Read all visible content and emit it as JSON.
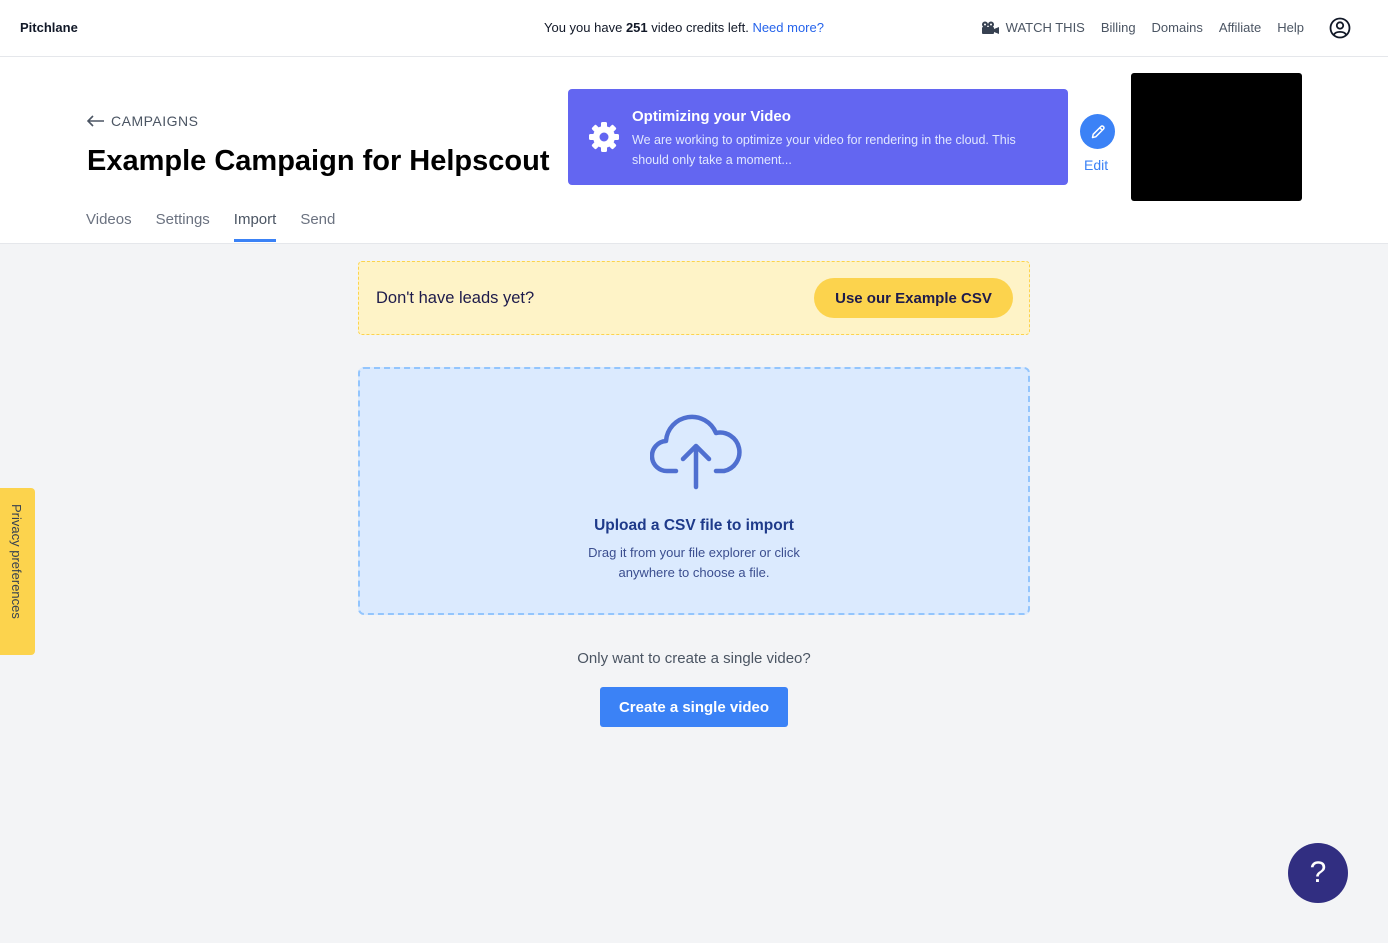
{
  "topbar": {
    "brand": "Pitchlane",
    "credits_prefix": "You you have",
    "credits_count": "251",
    "credits_suffix": "video credits left.",
    "need_more": "Need more?",
    "nav": {
      "watch": "WATCH THIS",
      "billing": "Billing",
      "domains": "Domains",
      "affiliate": "Affiliate",
      "help": "Help"
    }
  },
  "header": {
    "back_label": "CAMPAIGNS",
    "title": "Example Campaign for Helpscout",
    "tabs": [
      {
        "label": "Videos",
        "active": false
      },
      {
        "label": "Settings",
        "active": false
      },
      {
        "label": "Import",
        "active": true
      },
      {
        "label": "Send",
        "active": false
      }
    ]
  },
  "optimizing": {
    "title": "Optimizing your Video",
    "description": "We are working to optimize your video for rendering in the cloud. This should only take a moment..."
  },
  "edit_label": "Edit",
  "leads_banner": {
    "text": "Don't have leads yet?",
    "button": "Use our Example CSV"
  },
  "upload": {
    "title": "Upload a CSV file to import",
    "subtitle": "Drag it from your file explorer or click anywhere to choose a file."
  },
  "single": {
    "question": "Only want to create a single video?",
    "button": "Create a single video"
  },
  "privacy_tab": "Privacy preferences",
  "help_fab": "?",
  "colors": {
    "accent": "#3b82f6",
    "banner": "#6366f1",
    "yellow": "#fcd34d",
    "upload_bg": "#dbeafe"
  }
}
